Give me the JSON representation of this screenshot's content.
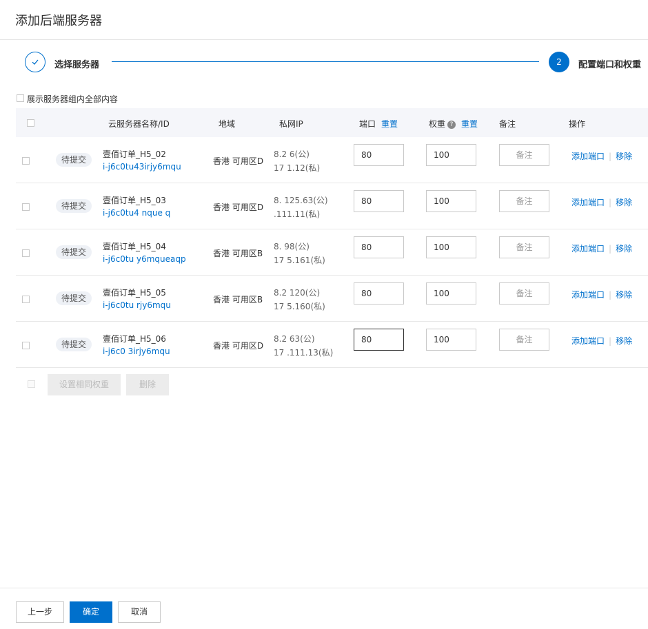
{
  "dialog": {
    "title": "添加后端服务器"
  },
  "steps": [
    {
      "label": "选择服务器",
      "state": "done",
      "icon": "check-icon"
    },
    {
      "label": "配置端口和权重",
      "number": "2",
      "state": "active"
    }
  ],
  "filter": {
    "show_all_label": "展示服务器组内全部内容"
  },
  "table": {
    "headers": {
      "name": "云服务器名称/ID",
      "region": "地域",
      "ip": "私网IP",
      "port": "端口",
      "port_reset": "重置",
      "weight": "权重",
      "weight_reset": "重置",
      "note": "备注",
      "ops": "操作"
    },
    "rows": [
      {
        "status": "待提交",
        "name": "壹佰订单_H5_02",
        "id": "i-j6c0tu43irjy6mqu",
        "region": "香港 可用区D",
        "public_ip": "8.2      6(公)",
        "private_ip": "17         1.12(私)",
        "port": "80",
        "weight": "100"
      },
      {
        "status": "待提交",
        "name": "壹佰订单_H5_03",
        "id": "i-j6c0tu4        nque   q",
        "region": "香港 可用区D",
        "public_ip": "8.      125.63(公)",
        "private_ip": "      .111.11(私)",
        "port": "80",
        "weight": "100"
      },
      {
        "status": "待提交",
        "name": "壹佰订单_H5_04",
        "id": "i-j6c0tu      y6mqueaqp",
        "region": "香港 可用区B",
        "public_ip": "8.      98(公)",
        "private_ip": "17       5.161(私)",
        "port": "80",
        "weight": "100"
      },
      {
        "status": "待提交",
        "name": "壹佰订单_H5_05",
        "id": "i-j6c0tu      rjy6mqu",
        "region": "香港 可用区B",
        "public_ip": "8.2       120(公)",
        "private_ip": "17       5.160(私)",
        "port": "80",
        "weight": "100"
      },
      {
        "status": "待提交",
        "name": "壹佰订单_H5_06",
        "id": "i-j6c0      3irjy6mqu",
        "region": "香港 可用区D",
        "public_ip": "8.2      63(公)",
        "private_ip": "17   .111.13(私)",
        "port": "80",
        "weight": "100"
      }
    ],
    "note_placeholder": "备注",
    "op_add_port": "添加端口",
    "op_remove": "移除"
  },
  "batch": {
    "same_weight": "设置相同权重",
    "delete": "删除"
  },
  "footer": {
    "prev": "上一步",
    "ok": "确定",
    "cancel": "取消"
  },
  "colors": {
    "accent": "#0070cc",
    "link": "#0070cc"
  }
}
